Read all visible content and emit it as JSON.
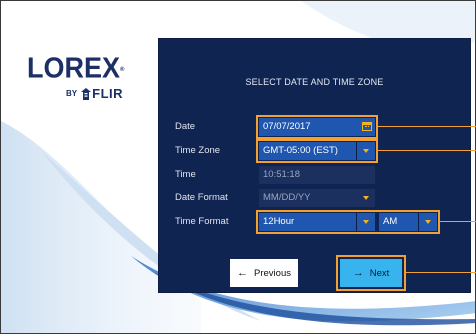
{
  "brand": {
    "logo": "LOREX",
    "by": "BY",
    "flir": "FLIR"
  },
  "dialog": {
    "title": "SELECT DATE AND TIME ZONE",
    "date": {
      "label": "Date",
      "value": "07/07/2017"
    },
    "time_zone": {
      "label": "Time Zone",
      "value": "GMT-05:00 (EST)"
    },
    "time": {
      "label": "Time",
      "value": "10:51:18"
    },
    "date_format": {
      "label": "Date Format",
      "value": "MM/DD/YY"
    },
    "time_format": {
      "label": "Time Format",
      "value": "12Hour",
      "ampm": "AM"
    },
    "previous_label": "Previous",
    "next_label": "Next"
  },
  "colors": {
    "panel": "#102452",
    "field": "#1f56b0",
    "highlight": "#f2a031",
    "next": "#37b4ee",
    "dropdown_arrow": "#f3b320"
  },
  "icons": [
    "calendar-icon",
    "chevron-down-icon",
    "arrow-left-icon",
    "arrow-right-icon"
  ]
}
